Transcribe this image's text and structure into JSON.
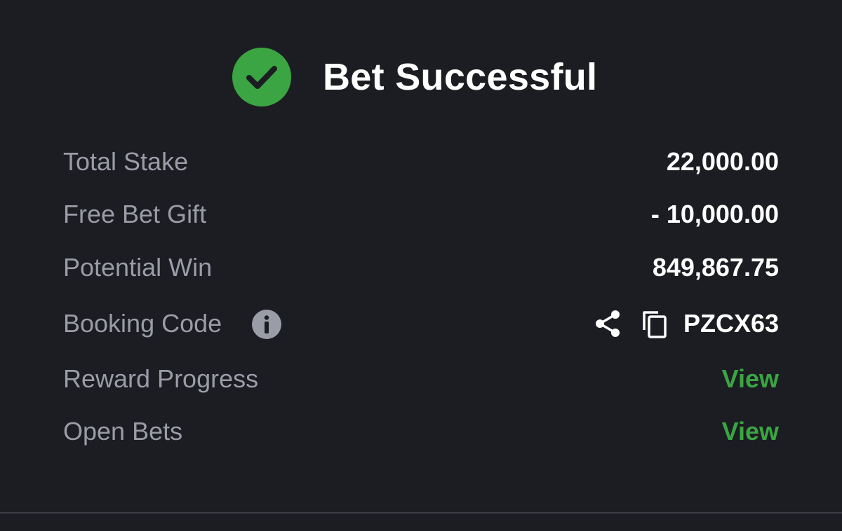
{
  "header": {
    "title": "Bet Successful",
    "icon": "check-circle-icon",
    "icon_color": "#3aa542"
  },
  "summary": {
    "total_stake": {
      "label": "Total Stake",
      "value": "22,000.00"
    },
    "free_bet_gift": {
      "label": "Free Bet Gift",
      "value": "- 10,000.00"
    },
    "potential_win": {
      "label": "Potential Win",
      "value": "849,867.75"
    },
    "booking_code": {
      "label": "Booking Code",
      "info_icon": "info-icon",
      "share_icon": "share-icon",
      "copy_icon": "copy-icon",
      "value": "PZCX63"
    },
    "reward_progress": {
      "label": "Reward Progress",
      "link": "View"
    },
    "open_bets": {
      "label": "Open Bets",
      "link": "View"
    }
  },
  "colors": {
    "background": "#1c1d22",
    "label": "#9a9ca7",
    "value": "#ffffff",
    "accent": "#3aa542"
  }
}
